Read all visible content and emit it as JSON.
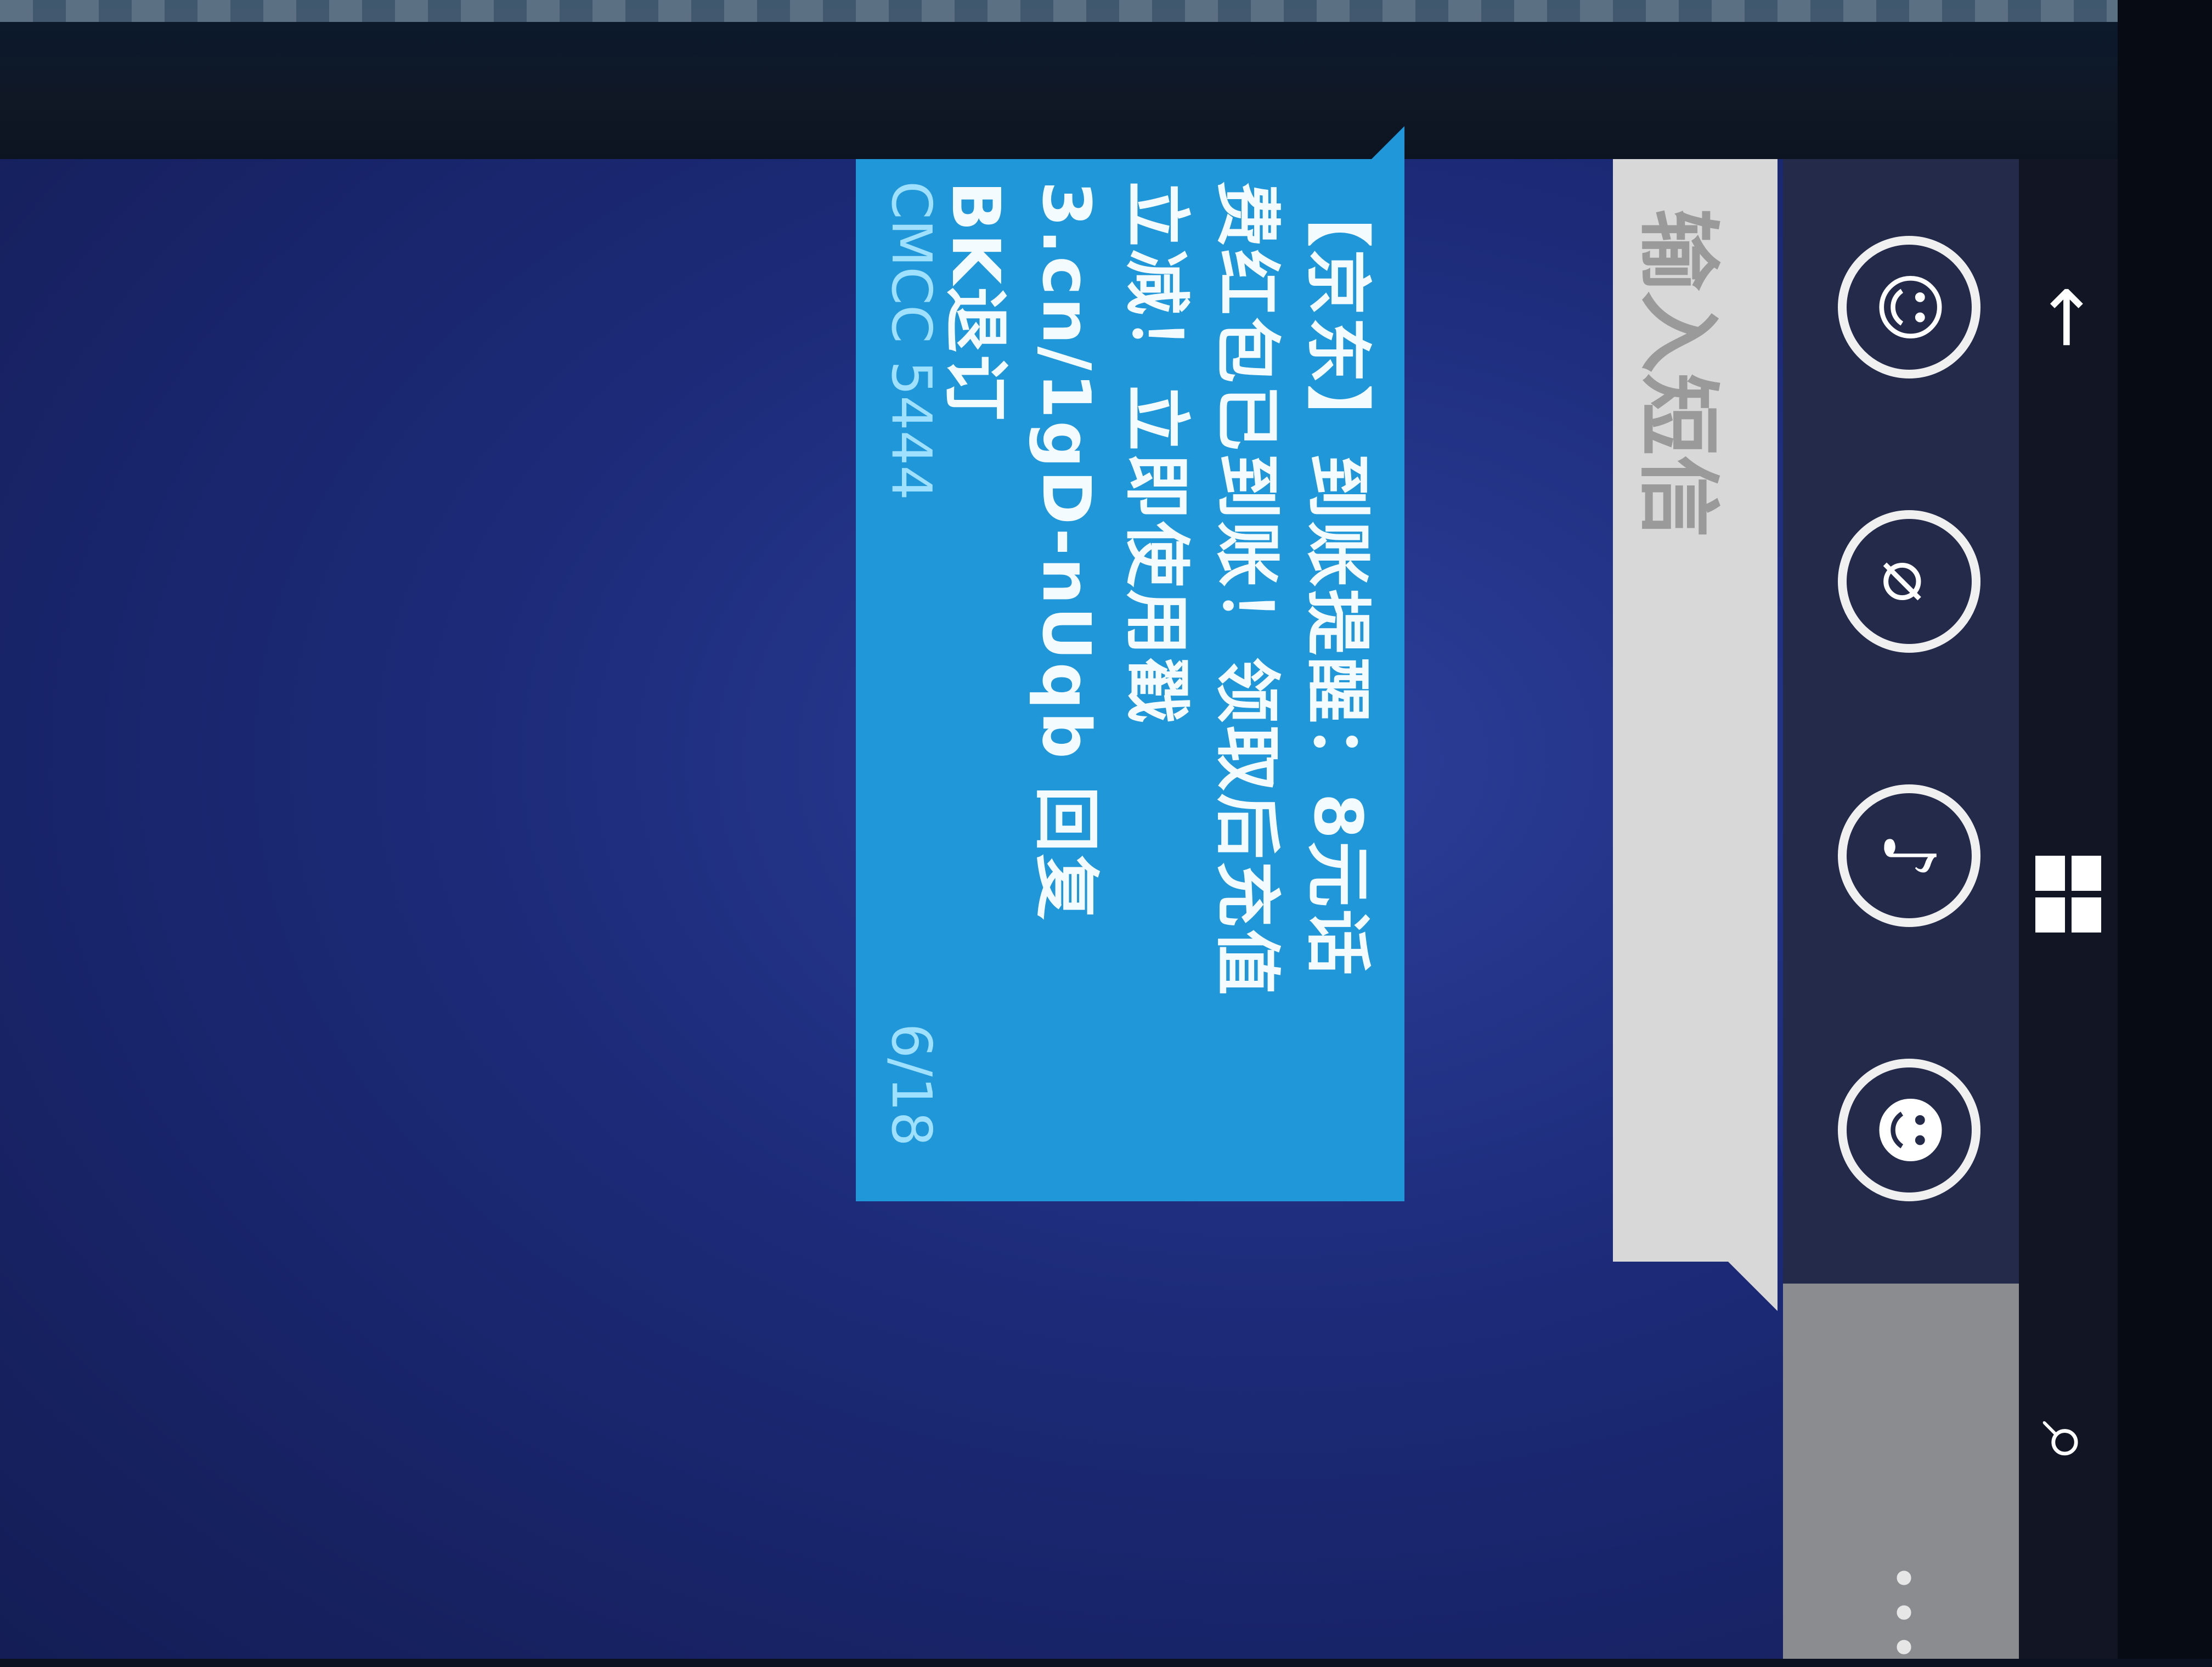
{
  "message": {
    "text": "【京东】到账提醒：8元话费红包已到账！领取后充值立减！立即使用戳 3.cn/1gD-nUqb 回复BK退订",
    "sender": "CMCC 5444",
    "counter": "6/18"
  },
  "compose": {
    "placeholder": "输入短信"
  },
  "appbar": {
    "buttons": [
      {
        "name": "emoji",
        "icon": "emoji-icon"
      },
      {
        "name": "attach",
        "icon": "paperclip-icon"
      },
      {
        "name": "voice",
        "icon": "microphone-icon"
      },
      {
        "name": "contact",
        "icon": "contact-icon"
      }
    ],
    "more_label": "•••"
  },
  "navbar": {
    "back_glyph": "←",
    "search_glyph": "⌕"
  },
  "colors": {
    "bubble": "#1f97d8",
    "screen_bg": "#1c2a78",
    "appbar": "#242a4a"
  }
}
